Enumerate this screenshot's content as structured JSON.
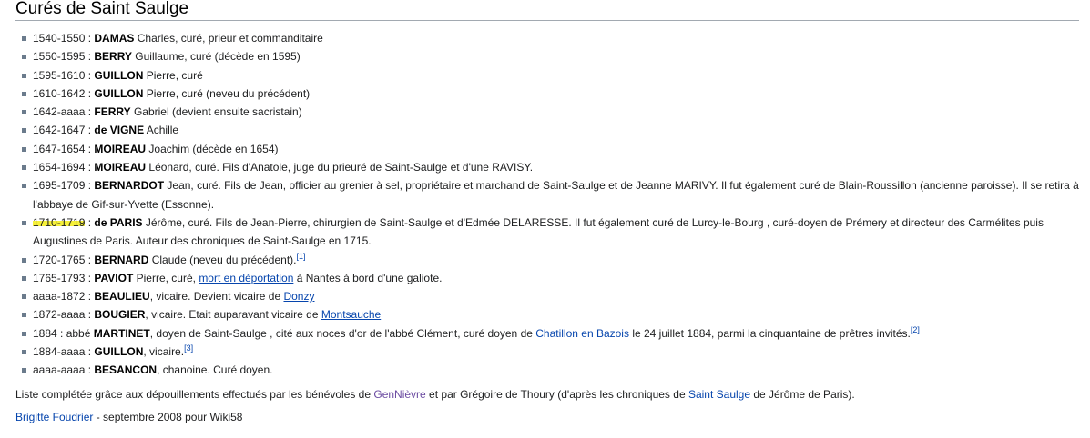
{
  "title": "Curés de Saint Saulge",
  "items": [
    {
      "date": "1540-1550 : ",
      "name": "DAMAS",
      "rest": " Charles, curé, prieur et commanditaire"
    },
    {
      "date": "1550-1595 : ",
      "name": "BERRY",
      "rest": " Guillaume, curé (décède en 1595)"
    },
    {
      "date": "1595-1610 : ",
      "name": "GUILLON",
      "rest": " Pierre, curé"
    },
    {
      "date": "1610-1642 : ",
      "name": "GUILLON",
      "rest": " Pierre, curé (neveu du précédent)"
    },
    {
      "date": "1642-aaaa : ",
      "name": "FERRY",
      "rest": " Gabriel (devient ensuite sacristain)"
    },
    {
      "date": "1642-1647 : ",
      "name": "de VIGNE",
      "rest": " Achille"
    },
    {
      "date": "1647-1654 : ",
      "name": "MOIREAU",
      "rest": " Joachim (décède en 1654)"
    },
    {
      "date": "1654-1694 : ",
      "name": "MOIREAU",
      "rest": " Léonard, curé. Fils d'Anatole, juge du prieuré de Saint-Saulge et d'une RAVISY."
    },
    {
      "date": "1695-1709 : ",
      "name": "BERNARDOT",
      "rest": " Jean, curé. Fils de Jean, officier au grenier à sel, propriétaire et marchand de Saint-Saulge et de Jeanne MARIVY. Il fut également curé de Blain-Roussillon (ancienne paroisse). Il se retira à l'abbaye de Gif-sur-Yvette (Essonne)."
    },
    {
      "date": "1710-1719",
      "after_date": " : ",
      "name": "de PARIS",
      "rest": " Jérôme, curé. Fils de Jean-Pierre, chirurgien de Saint-Saulge et d'Edmée DELARESSE. Il fut également curé de Lurcy-le-Bourg , curé-doyen de Prémery et directeur des Carmélites puis Augustines de Paris. Auteur des chroniques de Saint-Saulge en 1715."
    },
    {
      "date": "1720-1765 : ",
      "name": "BERNARD",
      "rest": " Claude (neveu du précédent).",
      "ref": "[1]"
    },
    {
      "date": "1765-1793 : ",
      "name": "PAVIOT",
      "rest": " Pierre, curé, ",
      "link": "mort en déportation",
      "rest2": " à Nantes à bord d'une galiote."
    },
    {
      "date": "aaaa-1872 : ",
      "name": "BEAULIEU",
      "rest": ", vicaire. Devient vicaire de ",
      "link": "Donzy"
    },
    {
      "date": "1872-aaaa : ",
      "name": "BOUGIER",
      "rest": ", vicaire. Etait auparavant vicaire de ",
      "link": "Montsauche"
    },
    {
      "date": "1884 : abbé ",
      "name": "MARTINET",
      "rest": ", doyen de Saint-Saulge , cité aux noces d'or de l'abbé Clément, curé doyen de ",
      "link": "Chatillon en Bazois",
      "rest2": " le 24 juillet 1884, parmi la cinquantaine de prêtres invités.",
      "ref": "[2]"
    },
    {
      "date": "1884-aaaa : ",
      "name": "GUILLON",
      "rest": ", vicaire.",
      "ref": "[3]"
    },
    {
      "date": "aaaa-aaaa : ",
      "name": "BESANCON",
      "rest": ", chanoine. Curé doyen."
    }
  ],
  "footer": {
    "p1": "Liste complétée grâce aux dépouillements effectués par les bénévoles de ",
    "link1": "GenNièvre",
    "p2": " et par Grégoire de Thoury (d'après les chroniques de ",
    "link2": "Saint Saulge",
    "p3": " de Jérôme de Paris).",
    "author": "Brigitte Foudrier",
    "author_rest": " - septembre 2008 pour Wiki58"
  }
}
